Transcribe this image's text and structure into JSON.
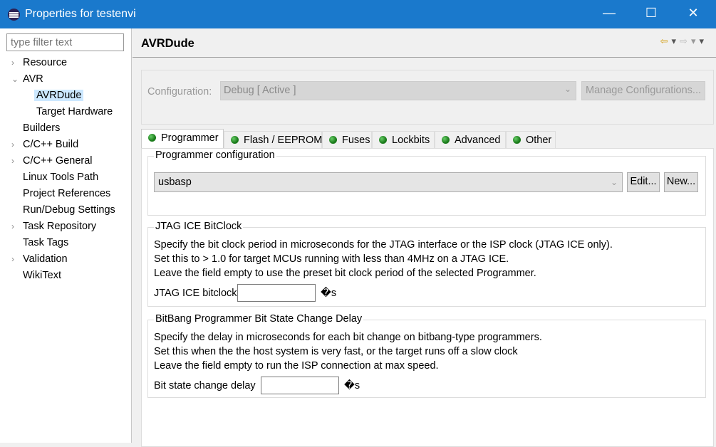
{
  "window": {
    "title": "Properties for testenvi",
    "minimize": "—",
    "maximize": "☐",
    "close": "✕"
  },
  "sidebar": {
    "filter_placeholder": "type filter text",
    "items": [
      {
        "label": "Resource",
        "expander": "›",
        "level": 0
      },
      {
        "label": "AVR",
        "expander": "⌄",
        "level": 0
      },
      {
        "label": "AVRDude",
        "level": 1,
        "selected": true
      },
      {
        "label": "Target Hardware",
        "level": 1
      },
      {
        "label": "Builders",
        "level": 0
      },
      {
        "label": "C/C++ Build",
        "expander": "›",
        "level": 0
      },
      {
        "label": "C/C++ General",
        "expander": "›",
        "level": 0
      },
      {
        "label": "Linux Tools Path",
        "level": 0
      },
      {
        "label": "Project References",
        "level": 0
      },
      {
        "label": "Run/Debug Settings",
        "level": 0
      },
      {
        "label": "Task Repository",
        "expander": "›",
        "level": 0
      },
      {
        "label": "Task Tags",
        "level": 0
      },
      {
        "label": "Validation",
        "expander": "›",
        "level": 0
      },
      {
        "label": "WikiText",
        "level": 0
      }
    ]
  },
  "page": {
    "title": "AVRDude",
    "configuration": {
      "label": "Configuration:",
      "value": "Debug  [ Active ]",
      "manage_button": "Manage Configurations..."
    },
    "tabs": [
      "Programmer",
      "Flash / EEPROM",
      "Fuses",
      "Lockbits",
      "Advanced",
      "Other"
    ],
    "programmer": {
      "legend": "Programmer configuration",
      "value": "usbasp",
      "edit_button": "Edit...",
      "new_button": "New..."
    },
    "jtag": {
      "legend": "JTAG ICE BitClock",
      "lines": [
        "Specify the bit clock period in microseconds for the JTAG interface or the ISP clock (JTAG ICE only).",
        "Set this to > 1.0 for target MCUs running with less than 4MHz on a JTAG ICE.",
        "Leave the field empty to use the preset bit clock period of the selected Programmer."
      ],
      "field_label": "JTAG ICE bitclock",
      "value": "",
      "unit": "�s"
    },
    "bitbang": {
      "legend": "BitBang Programmer Bit State Change Delay",
      "lines": [
        "Specify the delay in microseconds for each bit change on bitbang-type programmers.",
        "Set this when the the host system is very fast, or the target runs off a slow clock",
        "Leave the field empty to run the ISP connection at max speed."
      ],
      "field_label": "Bit state change delay",
      "value": "",
      "unit": "�s"
    }
  }
}
